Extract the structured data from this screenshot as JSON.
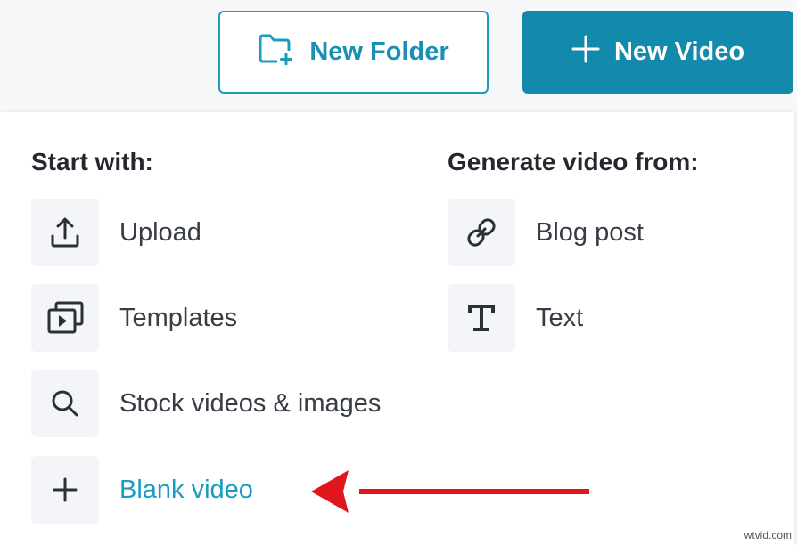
{
  "header": {
    "new_folder_label": "New Folder",
    "new_video_label": "New Video"
  },
  "menu": {
    "start_heading": "Start with:",
    "start_items": [
      {
        "label": "Upload",
        "icon": "upload-icon"
      },
      {
        "label": "Templates",
        "icon": "templates-icon"
      },
      {
        "label": "Stock videos & images",
        "icon": "search-icon"
      },
      {
        "label": "Blank video",
        "icon": "plus-icon"
      }
    ],
    "generate_heading": "Generate video from:",
    "generate_items": [
      {
        "label": "Blog post",
        "icon": "link-icon"
      },
      {
        "label": "Text",
        "icon": "text-icon"
      }
    ]
  },
  "watermark": "wtvid.com",
  "colors": {
    "accent": "#1a9bbf",
    "primary_button": "#1389ab",
    "arrow": "#e0161d"
  }
}
